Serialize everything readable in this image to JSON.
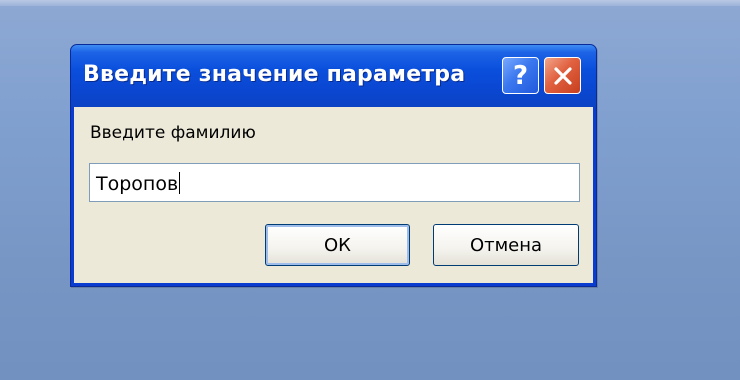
{
  "dialog": {
    "title": "Введите значение параметра",
    "help_button": "?",
    "prompt": "Введите фамилию",
    "input_value": "Торопов",
    "ok_label": "ОК",
    "cancel_label": "Отмена"
  },
  "colors": {
    "titlebar": "#0a4fdc",
    "client": "#ece9d8",
    "close_button": "#e0603f",
    "help_button": "#3b78ef",
    "desktop": "#7f9fcf"
  },
  "icons": {
    "help": "question-mark-icon",
    "close": "close-icon"
  }
}
